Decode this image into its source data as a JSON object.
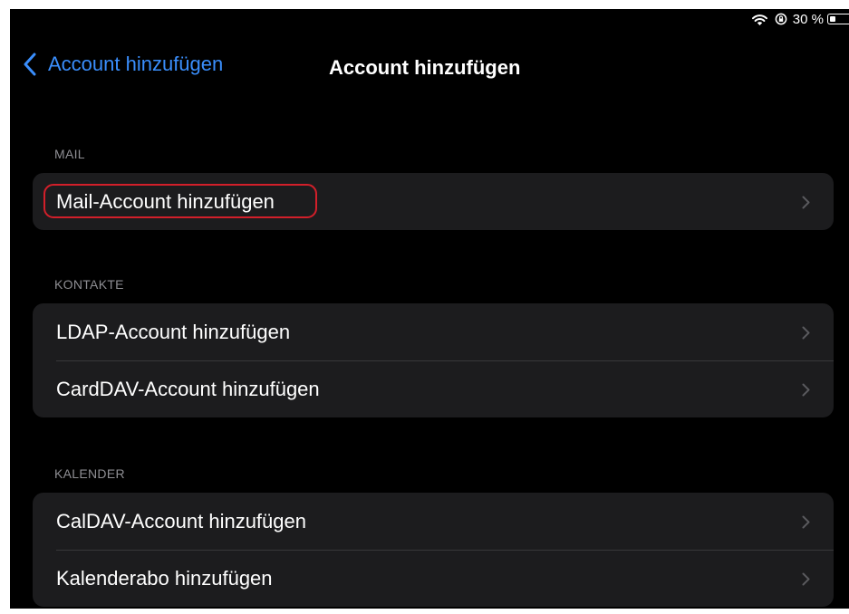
{
  "status_bar": {
    "battery_text": "30 %",
    "battery_level": 0.3,
    "icons": [
      "wifi-icon",
      "lock-rotation-icon",
      "battery-icon"
    ]
  },
  "nav": {
    "back_label": "Account hinzufügen",
    "title": "Account hinzufügen"
  },
  "sections": {
    "mail": {
      "header": "MAIL",
      "rows": [
        "Mail-Account hinzufügen"
      ]
    },
    "contacts": {
      "header": "KONTAKTE",
      "rows": [
        "LDAP-Account hinzufügen",
        "CardDAV-Account hinzufügen"
      ]
    },
    "calendar": {
      "header": "KALENDER",
      "rows": [
        "CalDAV-Account hinzufügen",
        "Kalenderabo hinzufügen"
      ]
    }
  },
  "colors": {
    "background": "#000000",
    "cell": "#1c1c1e",
    "accent": "#3a8efc",
    "highlight": "#d21f2a",
    "secondary_text": "#8e8e93"
  }
}
